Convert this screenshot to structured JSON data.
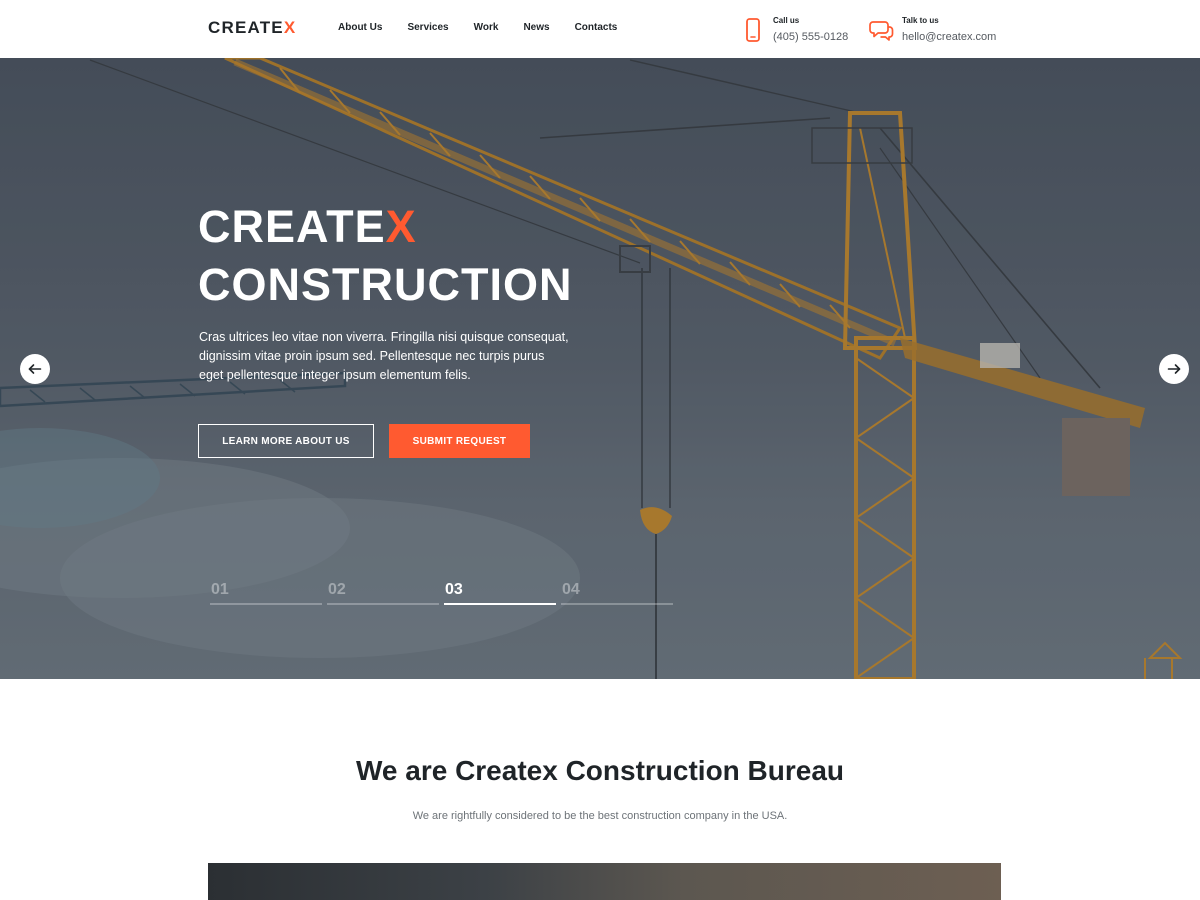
{
  "brand": {
    "name_main": "CREATE",
    "name_accent": "X"
  },
  "nav": {
    "items": [
      {
        "label": "About Us"
      },
      {
        "label": "Services"
      },
      {
        "label": "Work"
      },
      {
        "label": "News"
      },
      {
        "label": "Contacts"
      }
    ]
  },
  "contacts": {
    "phone": {
      "label": "Call us",
      "value": "(405) 555-0128",
      "icon": "phone-icon"
    },
    "email": {
      "label": "Talk to us",
      "value": "hello@createx.com",
      "icon": "chat-icon"
    }
  },
  "hero": {
    "title_line1_main": "CREATE",
    "title_line1_accent": "X",
    "title_line2": "CONSTRUCTION",
    "text": "Cras ultrices leo vitae non viverra. Fringilla nisi quisque consequat, dignissim vitae proin ipsum sed. Pellentesque nec turpis purus eget pellentesque integer ipsum elementum felis.",
    "learn_more_label": "LEARN MORE ABOUT US",
    "submit_label": "SUBMIT REQUEST",
    "prev_icon": "arrow-left-icon",
    "next_icon": "arrow-right-icon",
    "slides": [
      {
        "label": "01",
        "active": false
      },
      {
        "label": "02",
        "active": false
      },
      {
        "label": "03",
        "active": true
      },
      {
        "label": "04",
        "active": false
      }
    ]
  },
  "about": {
    "title": "We are Createx Construction Bureau",
    "subtitle": "We are rightfully considered to be the best construction company in the USA."
  },
  "colors": {
    "accent": "#ff5a30",
    "dark": "#1f2428",
    "white": "#ffffff"
  }
}
